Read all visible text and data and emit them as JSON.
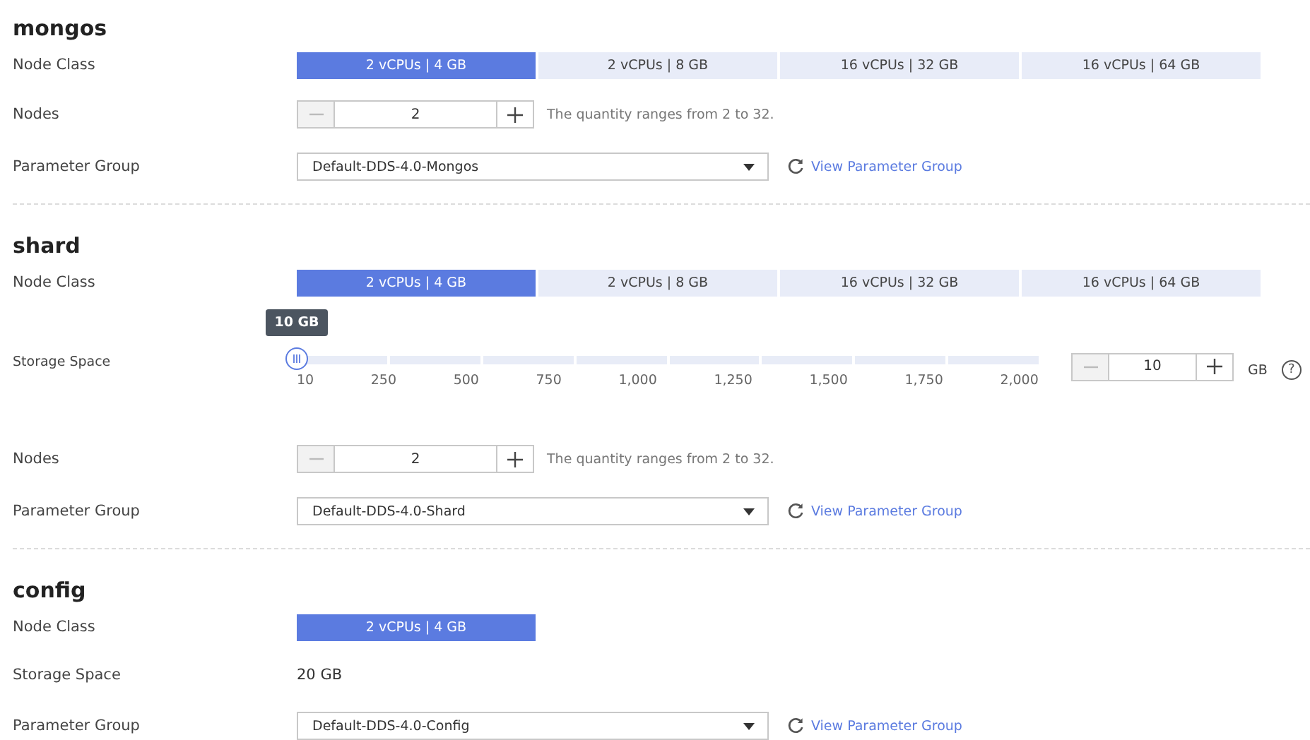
{
  "sections": [
    {
      "title": "mongos",
      "rows": [
        {
          "kind": "node_class",
          "label": "Node Class",
          "options": [
            {
              "label": "2 vCPUs | 4 GB",
              "selected": true
            },
            {
              "label": "2 vCPUs | 8 GB",
              "selected": false
            },
            {
              "label": "16 vCPUs | 32 GB",
              "selected": false
            },
            {
              "label": "16 vCPUs | 64 GB",
              "selected": false
            }
          ]
        },
        {
          "kind": "nodes",
          "label": "Nodes",
          "value": "2",
          "minus_disabled": true,
          "hint": "The quantity ranges from 2 to 32."
        },
        {
          "kind": "param_group",
          "label": "Parameter Group",
          "value": "Default-DDS-4.0-Mongos",
          "link": "View Parameter Group"
        }
      ]
    },
    {
      "title": "shard",
      "rows": [
        {
          "kind": "node_class",
          "label": "Node Class",
          "options": [
            {
              "label": "2 vCPUs | 4 GB",
              "selected": true
            },
            {
              "label": "2 vCPUs | 8 GB",
              "selected": false
            },
            {
              "label": "16 vCPUs | 32 GB",
              "selected": false
            },
            {
              "label": "16 vCPUs | 64 GB",
              "selected": false
            }
          ]
        },
        {
          "kind": "storage_slider",
          "label": "Storage Space",
          "tooltip": "10 GB",
          "level": 0,
          "ticks": [
            "10",
            "250",
            "500",
            "750",
            "1,000",
            "1,250",
            "1,500",
            "1,750",
            "2,000"
          ],
          "value": "10",
          "minus_disabled": true,
          "unit": "GB",
          "help": "?"
        },
        {
          "kind": "nodes",
          "label": "Nodes",
          "value": "2",
          "minus_disabled": true,
          "hint": "The quantity ranges from 2 to 32."
        },
        {
          "kind": "param_group",
          "label": "Parameter Group",
          "value": "Default-DDS-4.0-Shard",
          "link": "View Parameter Group"
        }
      ]
    },
    {
      "title": "config",
      "rows": [
        {
          "kind": "node_class",
          "label": "Node Class",
          "options": [
            {
              "label": "2 vCPUs | 4 GB",
              "selected": true
            }
          ]
        },
        {
          "kind": "storage_text",
          "label": "Storage Space",
          "value": "20 GB"
        },
        {
          "kind": "param_group",
          "label": "Parameter Group",
          "value": "Default-DDS-4.0-Config",
          "link": "View Parameter Group"
        }
      ]
    }
  ]
}
